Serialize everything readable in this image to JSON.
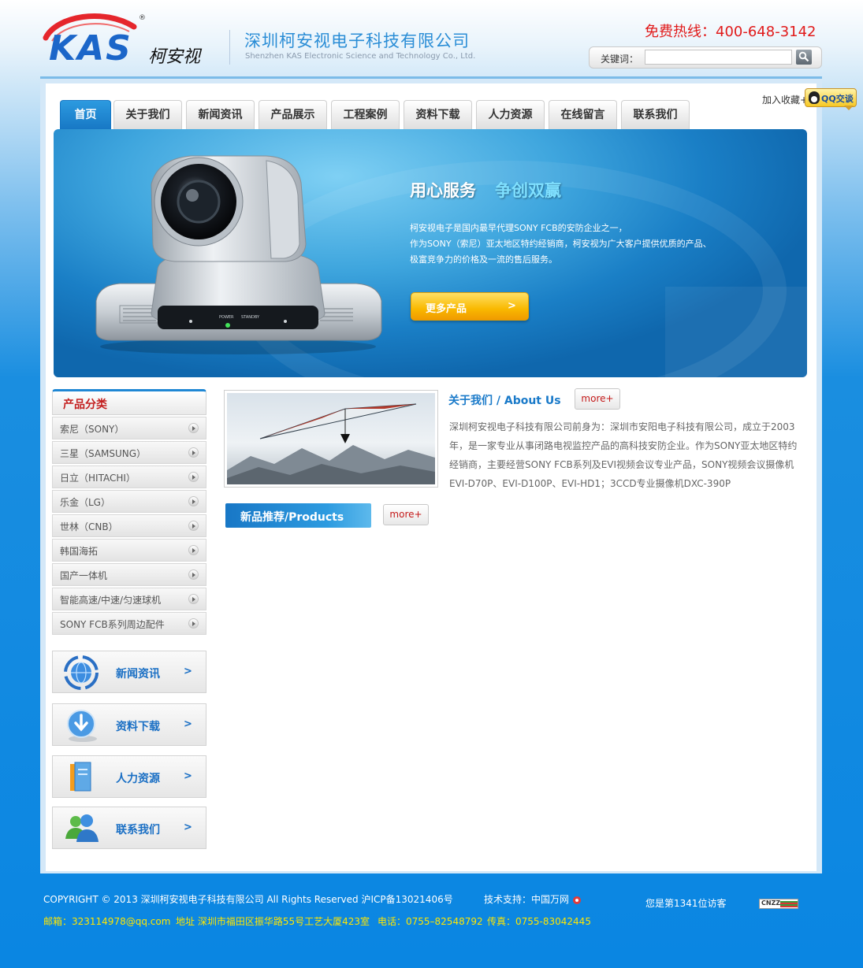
{
  "header": {
    "logo_text": "KAS",
    "logo_cn": "柯安视",
    "logo_reg": "®",
    "company_cn": "深圳柯安视电子科技有限公司",
    "company_en": "Shenzhen KAS Electronic Science and Technology Co., Ltd.",
    "hotline": "免费热线：400-648-3142",
    "search_label": "关键词：",
    "search_value": "",
    "search_icon": "magnifier-icon"
  },
  "nav": {
    "items": [
      "首页",
      "关于我们",
      "新闻资讯",
      "产品展示",
      "工程案例",
      "资料下载",
      "人力资源",
      "在线留言",
      "联系我们"
    ],
    "active_index": 0,
    "favorite": "加入收藏+",
    "qq_label": "QQ交谈"
  },
  "banner": {
    "title_main": "用心服务",
    "title_accent": "争创双赢",
    "lines": [
      "柯安视电子是国内最早代理SONY FCB的安防企业之一，",
      "作为SONY（索尼）亚太地区特约经销商，柯安视为广大客户提供优质的产品、",
      "极富竞争力的价格及一流的售后服务。"
    ],
    "button_label": "更多产品",
    "button_arrow": ">",
    "camera_power": "POWER",
    "camera_standby": "STANDBY"
  },
  "sidebar": {
    "category_title": "产品分类",
    "categories": [
      "索尼（SONY）",
      "三星（SAMSUNG）",
      "日立（HITACHI）",
      "乐金（LG）",
      "世林（CNB）",
      "韩国海拓",
      "国产一体机",
      "智能高速/中速/匀速球机",
      "SONY FCB系列周边配件"
    ],
    "links": [
      {
        "label": "新闻资讯",
        "icon": "globe-icon"
      },
      {
        "label": "资料下载",
        "icon": "download-icon"
      },
      {
        "label": "人力资源",
        "icon": "folder-icon"
      },
      {
        "label": "联系我们",
        "icon": "users-icon"
      }
    ],
    "arrow": ">"
  },
  "about": {
    "title": "关于我们 /  About Us",
    "more": "more+",
    "lines": [
      "深圳柯安视电子科技有限公司前身为：深圳市安阳电子科技有限公司，成立于2003",
      "年，是一家专业从事闭路电视监控产品的高科技安防企业。作为SONY亚太地区特约",
      "经销商，主要经营SONY FCB系列及EVI视频会议专业产品，SONY视频会议摄像机",
      "EVI-D70P、EVI-D100P、EVI-HD1；3CCD专业摄像机DXC-390P"
    ]
  },
  "products": {
    "title": "新品推荐/Products",
    "more": "more+"
  },
  "footer": {
    "copyright": "COPYRIGHT © 2013 深圳柯安视电子科技有限公司   All Rights Reserved   沪ICP备13021406号",
    "tech_support": "技术支持：中国万网",
    "visitor": "您是第1341位访客",
    "counter_badge": "CNZZ",
    "email": "邮箱：323114978@qq.com",
    "address": "地址 深圳市福田区振华路55号工艺大厦423室",
    "phone": "电话：0755–82548792",
    "fax": "传真：0755-83042445"
  },
  "colors": {
    "brand_blue": "#1a7ac9",
    "nav_active": "#1777c4",
    "hotline_red": "#e11a1a",
    "footer_yellow": "#ffe600",
    "banner_button": "#f9b800"
  }
}
